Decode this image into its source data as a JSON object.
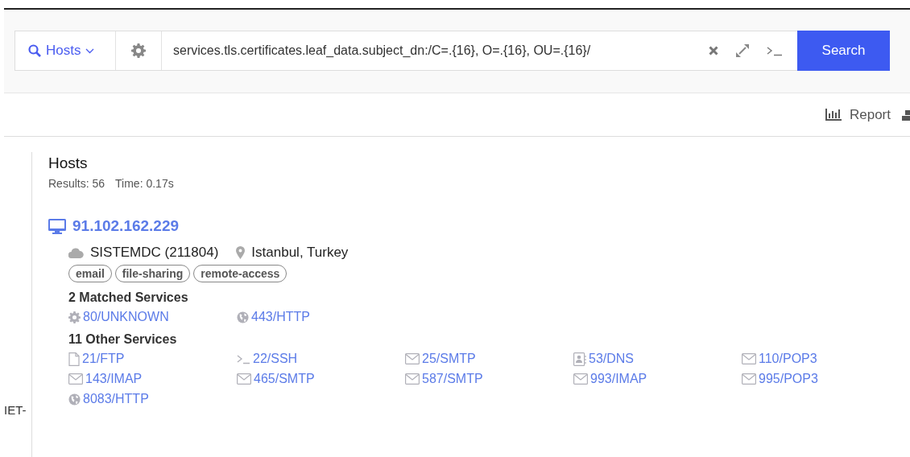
{
  "search_bar": {
    "scope": "Hosts",
    "query": "services.tls.certificates.leaf_data.subject_dn:/C=.{16}, O=.{16}, OU=.{16}/",
    "button": "Search"
  },
  "toolbar": {
    "report": "Report"
  },
  "sidebar": {
    "text": "IET-"
  },
  "results": {
    "title": "Hosts",
    "count": "Results: 56",
    "time": "Time: 0.17s",
    "host": {
      "ip": "91.102.162.229",
      "asn": "SISTEMDC (211804)",
      "location": "Istanbul, Turkey",
      "tags": [
        "email",
        "file-sharing",
        "remote-access"
      ],
      "matched_title": "2 Matched Services",
      "matched": [
        {
          "kind": "gear",
          "label": "80/UNKNOWN"
        },
        {
          "kind": "globe",
          "label": "443/HTTP"
        }
      ],
      "other_title": "11 Other Services",
      "other": [
        {
          "kind": "file",
          "label": "21/FTP"
        },
        {
          "kind": "terminal",
          "label": "22/SSH"
        },
        {
          "kind": "envelope",
          "label": "25/SMTP"
        },
        {
          "kind": "contact",
          "label": "53/DNS"
        },
        {
          "kind": "envelope",
          "label": "110/POP3"
        },
        {
          "kind": "envelope",
          "label": "143/IMAP"
        },
        {
          "kind": "envelope",
          "label": "465/SMTP"
        },
        {
          "kind": "envelope",
          "label": "587/SMTP"
        },
        {
          "kind": "envelope",
          "label": "993/IMAP"
        },
        {
          "kind": "envelope",
          "label": "995/POP3"
        },
        {
          "kind": "globe",
          "label": "8083/HTTP"
        }
      ]
    }
  }
}
